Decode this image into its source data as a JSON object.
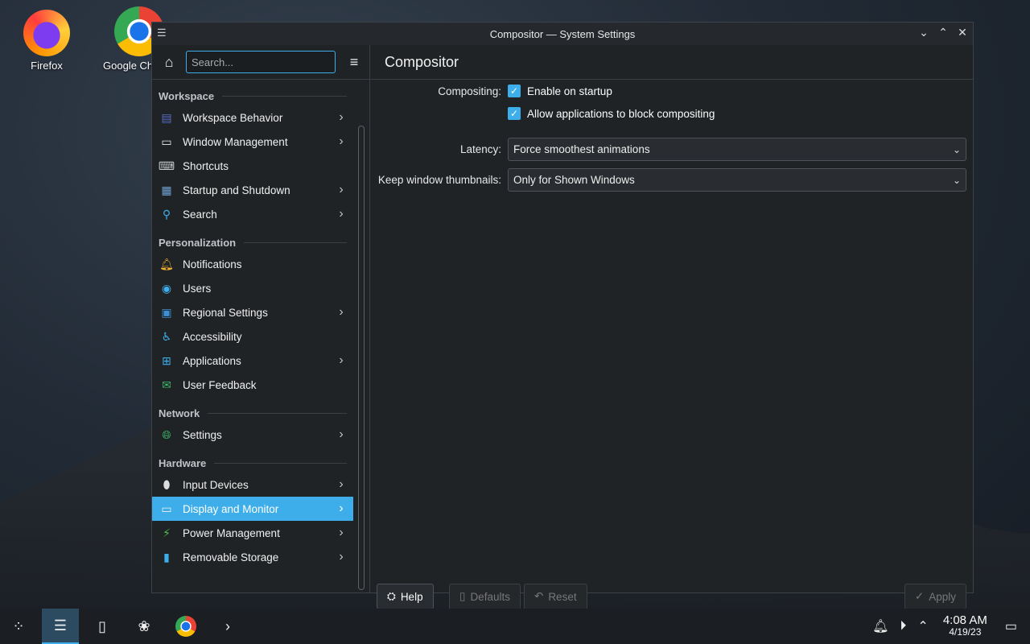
{
  "desktop": [
    {
      "label": "Firefox",
      "icon": "firefox-icon"
    },
    {
      "label": "Google Ch",
      "icon": "chrome-icon"
    }
  ],
  "window": {
    "title": "Compositor — System Settings",
    "controls": [
      "minimize",
      "maximize",
      "close"
    ]
  },
  "sidebar": {
    "search_placeholder": "Search...",
    "sections": [
      {
        "title": "Workspace",
        "items": [
          {
            "label": "Workspace Behavior",
            "icon": "workspace-behavior-icon",
            "has_children": true
          },
          {
            "label": "Window Management",
            "icon": "window-management-icon",
            "has_children": true
          },
          {
            "label": "Shortcuts",
            "icon": "keyboard-icon",
            "has_children": false
          },
          {
            "label": "Startup and Shutdown",
            "icon": "startup-icon",
            "has_children": true
          },
          {
            "label": "Search",
            "icon": "search-icon",
            "has_children": true
          }
        ]
      },
      {
        "title": "Personalization",
        "items": [
          {
            "label": "Notifications",
            "icon": "bell-icon",
            "has_children": false
          },
          {
            "label": "Users",
            "icon": "users-icon",
            "has_children": false
          },
          {
            "label": "Regional Settings",
            "icon": "regional-icon",
            "has_children": true
          },
          {
            "label": "Accessibility",
            "icon": "accessibility-icon",
            "has_children": false
          },
          {
            "label": "Applications",
            "icon": "applications-icon",
            "has_children": true
          },
          {
            "label": "User Feedback",
            "icon": "feedback-icon",
            "has_children": false
          }
        ]
      },
      {
        "title": "Network",
        "items": [
          {
            "label": "Settings",
            "icon": "globe-icon",
            "has_children": true
          }
        ]
      },
      {
        "title": "Hardware",
        "items": [
          {
            "label": "Input Devices",
            "icon": "mouse-icon",
            "has_children": true
          },
          {
            "label": "Display and Monitor",
            "icon": "monitor-icon",
            "has_children": true,
            "active": true
          },
          {
            "label": "Power Management",
            "icon": "power-icon",
            "has_children": true
          },
          {
            "label": "Removable Storage",
            "icon": "usb-icon",
            "has_children": true
          }
        ]
      }
    ]
  },
  "page": {
    "title": "Compositor",
    "compositing_label": "Compositing:",
    "enable_on_startup": "Enable on startup",
    "allow_block": "Allow applications to block compositing",
    "latency_label": "Latency:",
    "latency_value": "Force smoothest animations",
    "thumbnails_label": "Keep window thumbnails:",
    "thumbnails_value": "Only for Shown Windows"
  },
  "buttons": {
    "help": "Help",
    "defaults": "Defaults",
    "reset": "Reset",
    "apply": "Apply"
  },
  "taskbar": {
    "time": "4:08 AM",
    "date": "4/19/23"
  },
  "colors": {
    "accent": "#3daee9",
    "window_bg": "#202326"
  }
}
